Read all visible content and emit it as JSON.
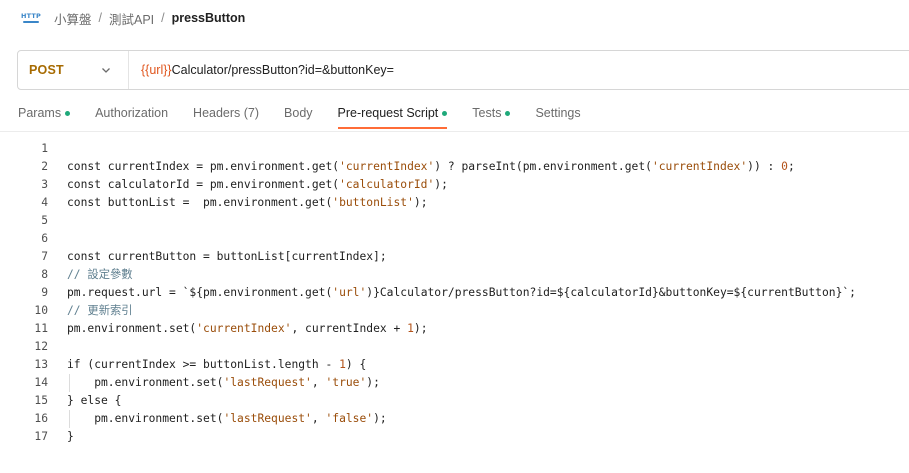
{
  "breadcrumb": {
    "icon_text": "HTTP",
    "items": [
      "小算盤",
      "測試API"
    ],
    "separator": "/",
    "current": "pressButton"
  },
  "request": {
    "method": "POST",
    "url_var": "{{url}}",
    "url_rest": "Calculator/pressButton?id=&buttonKey="
  },
  "tabs": [
    {
      "label": "Params",
      "dot": true
    },
    {
      "label": "Authorization",
      "dot": false
    },
    {
      "label": "Headers (7)",
      "dot": false
    },
    {
      "label": "Body",
      "dot": false
    },
    {
      "label": "Pre-request Script",
      "dot": true,
      "active": true
    },
    {
      "label": "Tests",
      "dot": true
    },
    {
      "label": "Settings",
      "dot": false
    }
  ],
  "colors": {
    "method": "#a66a00",
    "active_tab_underline": "#ff6c37",
    "dot": "#1fa97a",
    "url_variable": "#e0571f"
  },
  "code_lines": [
    "",
    "const currentIndex = pm.environment.get('currentIndex') ? parseInt(pm.environment.get('currentIndex')) : 0;",
    "const calculatorId = pm.environment.get('calculatorId');",
    "const buttonList =  pm.environment.get('buttonList');",
    "",
    "",
    "const currentButton = buttonList[currentIndex];",
    "// 設定參數",
    "pm.request.url = `${pm.environment.get('url')}Calculator/pressButton?id=${calculatorId}&buttonKey=${currentButton}`;",
    "// 更新索引",
    "pm.environment.set('currentIndex', currentIndex + 1);",
    "",
    "if (currentIndex >= buttonList.length - 1) {",
    "    pm.environment.set('lastRequest', 'true');",
    "} else {",
    "    pm.environment.set('lastRequest', 'false');",
    "}"
  ]
}
